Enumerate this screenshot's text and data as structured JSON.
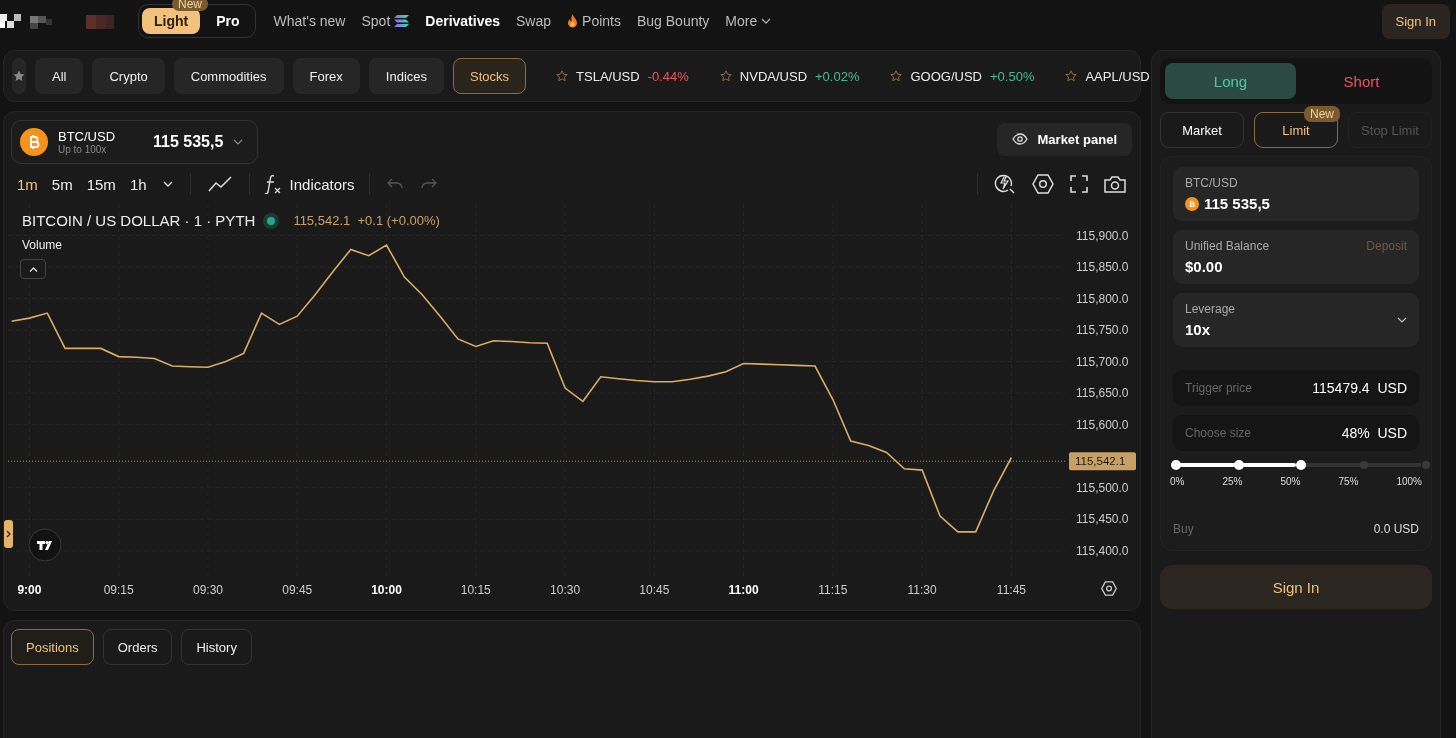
{
  "header": {
    "mode_toggle": {
      "badge": "New",
      "options": [
        {
          "label": "Light",
          "selected": true
        },
        {
          "label": "Pro",
          "selected": false
        }
      ]
    },
    "nav": [
      {
        "label": "What's new",
        "selected": false,
        "kind": "plain"
      },
      {
        "label": "Spot",
        "selected": false,
        "kind": "trailing-mark"
      },
      {
        "label": "Derivatives",
        "selected": true,
        "kind": "plain"
      },
      {
        "label": "Swap",
        "selected": false,
        "kind": "plain"
      },
      {
        "label": "Points",
        "selected": false,
        "kind": "leading-mark"
      },
      {
        "label": "Bug Bounty",
        "selected": false,
        "kind": "plain"
      },
      {
        "label": "More",
        "selected": false,
        "kind": "menu"
      }
    ],
    "sign_in": "Sign In"
  },
  "filter_bar": {
    "categories": [
      {
        "label": "All",
        "selected": false
      },
      {
        "label": "Crypto",
        "selected": false
      },
      {
        "label": "Commodities",
        "selected": false
      },
      {
        "label": "Forex",
        "selected": false
      },
      {
        "label": "Indices",
        "selected": false
      },
      {
        "label": "Stocks",
        "selected": true
      }
    ],
    "tickers": [
      {
        "symbol": "TSLA/USD",
        "change": "-0.44%",
        "color": "#f0525a"
      },
      {
        "symbol": "NVDA/USD",
        "change": "+0.02%",
        "color": "#3fbf96"
      },
      {
        "symbol": "GOOG/USD",
        "change": "+0.50%",
        "color": "#3fbf96"
      },
      {
        "symbol": "AAPL/USD"
      }
    ]
  },
  "chart_panel": {
    "pair": {
      "symbol": "BTC/USD",
      "leverage": "Up to 100x",
      "price": "115 535,5"
    },
    "market_panel": "Market panel",
    "intervals": [
      {
        "label": "1m",
        "selected": true
      },
      {
        "label": "5m",
        "selected": false
      },
      {
        "label": "15m",
        "selected": false
      },
      {
        "label": "1h",
        "selected": false
      }
    ],
    "indicators": "Indicators",
    "legend": {
      "title": "BITCOIN / US DOLLAR · 1 · PYTH",
      "quote": "115,542.1  +0.1 (+0.00%)"
    },
    "volume": "Volume",
    "chart_data": {
      "type": "line",
      "categories": [
        null,
        "9:00",
        null,
        null,
        null,
        null,
        "09:15",
        null,
        null,
        null,
        null,
        "09:30",
        null,
        null,
        null,
        null,
        "09:45",
        null,
        null,
        null,
        null,
        "10:00",
        null,
        null,
        null,
        null,
        "10:15",
        null,
        null,
        null,
        null,
        "10:30",
        null,
        null,
        null,
        null,
        "10:45",
        null,
        null,
        null,
        null,
        "11:00",
        null,
        null,
        null,
        null,
        "11:15",
        null,
        null,
        null,
        null,
        "11:30",
        null,
        null,
        null,
        null,
        "11:45"
      ],
      "series": [
        {
          "color": "#d9ad62",
          "values": [
            115764,
            115769,
            115777,
            115721,
            115721,
            115721,
            115708,
            115707,
            115705,
            115693,
            115692,
            115691,
            115700,
            115713,
            115777,
            115759,
            115772,
            115806,
            115843,
            115878,
            115868,
            115885,
            115834,
            115806,
            115772,
            115736,
            115724,
            115733,
            115732,
            115730,
            115729,
            115658,
            115637,
            115676,
            115673,
            115670,
            115668,
            115668,
            115672,
            115677,
            115684,
            115697,
            115696,
            115695,
            115694,
            115693,
            115640,
            115574,
            115567,
            115556,
            115530,
            115528,
            115455,
            115430,
            115430,
            115495,
            115548
          ]
        }
      ],
      "ylim": [
        115360,
        115950
      ],
      "yticks": [
        {
          "value": 115900,
          "label": "115,900.0"
        },
        {
          "value": 115850,
          "label": "115,850.0"
        },
        {
          "value": 115800,
          "label": "115,800.0"
        },
        {
          "value": 115750,
          "label": "115,750.0"
        },
        {
          "value": 115700,
          "label": "115,700.0"
        },
        {
          "value": 115650,
          "label": "115,650.0"
        },
        {
          "value": 115600,
          "label": "115,600.0"
        },
        {
          "value": 115500,
          "label": "115,500.0"
        },
        {
          "value": 115450,
          "label": "115,450.0"
        },
        {
          "value": 115400,
          "label": "115,400.0"
        }
      ],
      "grid": true,
      "ref_lines": [
        {
          "axis": "y",
          "value": 115542.1,
          "label": "115,542.1"
        }
      ]
    }
  },
  "bottom_panel": {
    "tabs": [
      {
        "label": "Positions",
        "selected": true
      },
      {
        "label": "Orders",
        "selected": false
      },
      {
        "label": "History",
        "selected": false
      }
    ]
  },
  "trade_panel": {
    "sides": [
      {
        "label": "Long",
        "selected": true,
        "kind": "long"
      },
      {
        "label": "Short",
        "selected": false,
        "kind": "short"
      }
    ],
    "order_types": [
      {
        "label": "Market",
        "selected": false,
        "disabled": false
      },
      {
        "label": "Limit",
        "selected": true,
        "disabled": false,
        "badge": "New"
      },
      {
        "label": "Stop Limit",
        "selected": false,
        "disabled": true
      }
    ],
    "pair_field": {
      "label": "BTC/USD",
      "value": "115 535,5"
    },
    "balance_field": {
      "label": "Unified Balance",
      "action": "Deposit",
      "value": "$0.00"
    },
    "leverage_field": {
      "label": "Leverage",
      "value": "10x"
    },
    "trigger_field": {
      "label": "Trigger price",
      "value": "115479.4",
      "unit": "USD"
    },
    "size_field": {
      "label": "Choose size",
      "value": "48%",
      "unit": "USD"
    },
    "size_slider": {
      "level": 0.48,
      "marks": [
        "0%",
        "25%",
        "50%",
        "75%",
        "100%"
      ]
    },
    "buy": {
      "label": "Buy",
      "value": "0.0",
      "unit": "USD"
    },
    "submit": "Sign In"
  }
}
